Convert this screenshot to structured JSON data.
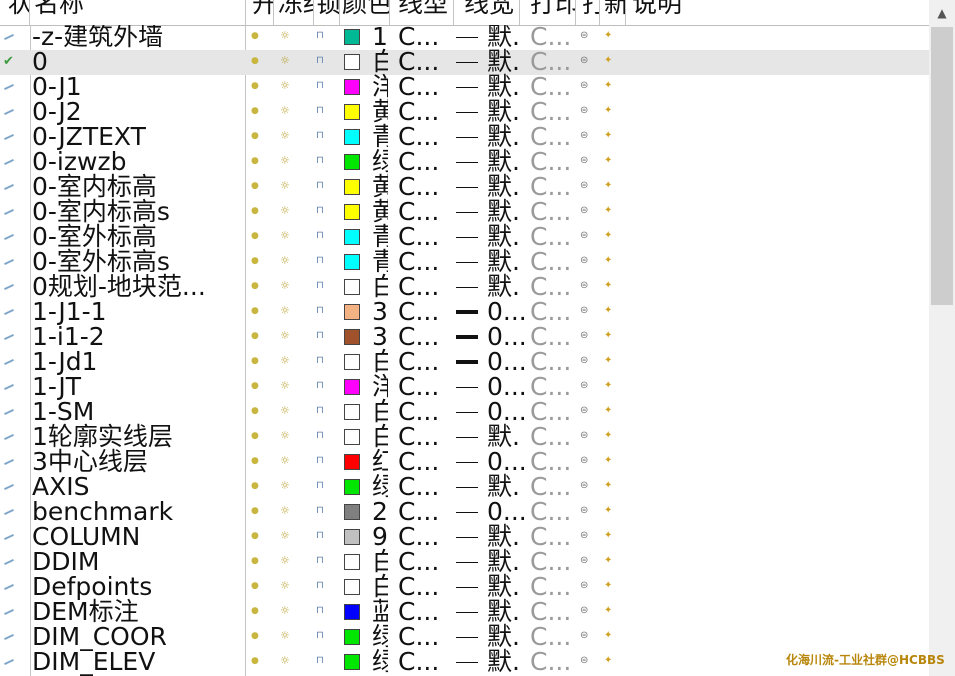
{
  "columns": [
    "状态",
    "名称",
    "开",
    "冻结",
    "锁定",
    "颜色",
    "线型",
    "线宽",
    "打印",
    "打印",
    "新视口冻结",
    "说明"
  ],
  "rows": [
    {
      "status": "edit",
      "name": "-z-建筑外墙",
      "color_hex": "#00b894",
      "color_name": "1",
      "linetype": "C...",
      "lw": "默.",
      "lw_thick": false,
      "plot": "C..."
    },
    {
      "status": "current",
      "name": "0",
      "color_hex": "#ffffff",
      "color_name": "白",
      "linetype": "C...",
      "lw": "默.",
      "lw_thick": false,
      "plot": "C...",
      "selected": true
    },
    {
      "status": "edit",
      "name": "0-J1",
      "color_hex": "#ff00ff",
      "color_name": "洋",
      "linetype": "C...",
      "lw": "默.",
      "lw_thick": false,
      "plot": "C..."
    },
    {
      "status": "edit",
      "name": "0-J2",
      "color_hex": "#ffff00",
      "color_name": "黄",
      "linetype": "C...",
      "lw": "默.",
      "lw_thick": false,
      "plot": "C..."
    },
    {
      "status": "edit",
      "name": "0-JZTEXT",
      "color_hex": "#00ffff",
      "color_name": "青",
      "linetype": "C...",
      "lw": "默.",
      "lw_thick": false,
      "plot": "C..."
    },
    {
      "status": "edit",
      "name": "0-izwzb",
      "color_hex": "#00e600",
      "color_name": "绿",
      "linetype": "C...",
      "lw": "默.",
      "lw_thick": false,
      "plot": "C..."
    },
    {
      "status": "edit",
      "name": "0-室内标高",
      "color_hex": "#ffff00",
      "color_name": "黄",
      "linetype": "C...",
      "lw": "默.",
      "lw_thick": false,
      "plot": "C..."
    },
    {
      "status": "edit",
      "name": "0-室内标高s",
      "color_hex": "#ffff00",
      "color_name": "黄",
      "linetype": "C...",
      "lw": "默.",
      "lw_thick": false,
      "plot": "C..."
    },
    {
      "status": "edit",
      "name": "0-室外标高",
      "color_hex": "#00ffff",
      "color_name": "青",
      "linetype": "C...",
      "lw": "默.",
      "lw_thick": false,
      "plot": "C..."
    },
    {
      "status": "edit",
      "name": "0-室外标高s",
      "color_hex": "#00ffff",
      "color_name": "青",
      "linetype": "C...",
      "lw": "默.",
      "lw_thick": false,
      "plot": "C..."
    },
    {
      "status": "edit",
      "name": "0规划-地块范...",
      "color_hex": "#ffffff",
      "color_name": "白",
      "linetype": "C...",
      "lw": "默.",
      "lw_thick": false,
      "plot": "C..."
    },
    {
      "status": "edit",
      "name": "1-J1-1",
      "color_hex": "#f4b183",
      "color_name": "3",
      "linetype": "C...",
      "lw": "0...",
      "lw_thick": true,
      "plot": "C..."
    },
    {
      "status": "edit",
      "name": "1-i1-2",
      "color_hex": "#a0522d",
      "color_name": "3",
      "linetype": "C...",
      "lw": "0...",
      "lw_thick": true,
      "plot": "C..."
    },
    {
      "status": "edit",
      "name": "1-Jd1",
      "color_hex": "#ffffff",
      "color_name": "白",
      "linetype": "C...",
      "lw": "0...",
      "lw_thick": true,
      "plot": "C..."
    },
    {
      "status": "edit",
      "name": "1-JT",
      "color_hex": "#ff00ff",
      "color_name": "洋",
      "linetype": "C...",
      "lw": "0...",
      "lw_thick": false,
      "plot": "C..."
    },
    {
      "status": "edit",
      "name": "1-SM",
      "color_hex": "#ffffff",
      "color_name": "白",
      "linetype": "C...",
      "lw": "0...",
      "lw_thick": false,
      "plot": "C..."
    },
    {
      "status": "edit",
      "name": "1轮廓实线层",
      "color_hex": "#ffffff",
      "color_name": "白",
      "linetype": "C...",
      "lw": "默.",
      "lw_thick": false,
      "plot": "C..."
    },
    {
      "status": "edit",
      "name": "3中心线层",
      "color_hex": "#ff0000",
      "color_name": "红",
      "linetype": "C...",
      "lw": "0...",
      "lw_thick": false,
      "plot": "C..."
    },
    {
      "status": "edit",
      "name": "AXIS",
      "color_hex": "#00e600",
      "color_name": "绿",
      "linetype": "C...",
      "lw": "默.",
      "lw_thick": false,
      "plot": "C..."
    },
    {
      "status": "edit",
      "name": "benchmark",
      "color_hex": "#808080",
      "color_name": "2",
      "linetype": "C...",
      "lw": "0...",
      "lw_thick": false,
      "plot": "C..."
    },
    {
      "status": "edit",
      "name": "COLUMN",
      "color_hex": "#c0c0c0",
      "color_name": "9",
      "linetype": "C...",
      "lw": "默.",
      "lw_thick": false,
      "plot": "C..."
    },
    {
      "status": "edit",
      "name": "DDIM",
      "color_hex": "#ffffff",
      "color_name": "白",
      "linetype": "C...",
      "lw": "默.",
      "lw_thick": false,
      "plot": "C..."
    },
    {
      "status": "edit",
      "name": "Defpoints",
      "color_hex": "#ffffff",
      "color_name": "白",
      "linetype": "C...",
      "lw": "默.",
      "lw_thick": false,
      "plot": "C..."
    },
    {
      "status": "edit",
      "name": "DEM标注",
      "color_hex": "#0000ff",
      "color_name": "蓝",
      "linetype": "C...",
      "lw": "默.",
      "lw_thick": false,
      "plot": "C..."
    },
    {
      "status": "edit",
      "name": "DIM_COOR",
      "color_hex": "#00e600",
      "color_name": "绿",
      "linetype": "C...",
      "lw": "默.",
      "lw_thick": false,
      "plot": "C..."
    },
    {
      "status": "edit",
      "name": "DIM_ELEV",
      "color_hex": "#00e600",
      "color_name": "绿",
      "linetype": "C...",
      "lw": "默.",
      "lw_thick": false,
      "plot": "C..."
    }
  ],
  "watermark": "化海川流-工业社群@HCBBS",
  "colors": {
    "selected_row": "#e6e6e6",
    "scroll_thumb": "#cdcdcd",
    "grid": "#c4c4c4"
  },
  "icons": {
    "status_edit": "pencil-icon",
    "status_current": "check-icon",
    "on": "bulb-icon",
    "freeze": "sun-icon",
    "lock": "unlock-icon",
    "plot": "printer-icon",
    "vp_freeze": "viewport-freeze-icon"
  }
}
